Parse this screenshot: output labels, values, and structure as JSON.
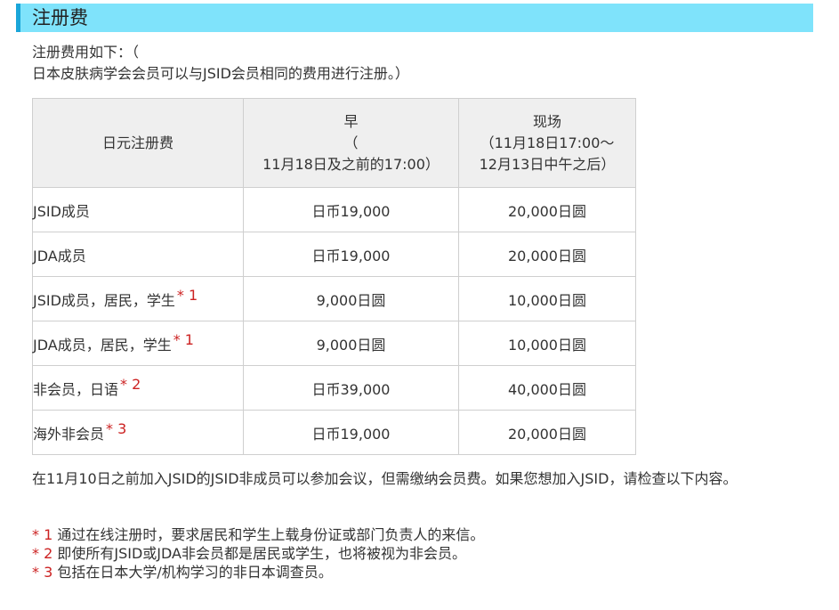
{
  "section": {
    "title": "注册费"
  },
  "intro": {
    "line1": "注册费用如下：（",
    "line2": "日本皮肤病学会会员可以与JSID会员相同的费用进行注册。）"
  },
  "fee_table": {
    "headers": {
      "category": "日元注册费",
      "early_title": "早",
      "early_paren": "（",
      "early_date": "11月18日及之前的17:00）",
      "onsite_title": "现场",
      "onsite_date1": "（11月18日17:00〜",
      "onsite_date2": "12月13日中午之后）"
    },
    "rows": [
      {
        "category": "JSID成员",
        "footnote": "",
        "early": "日币19,000",
        "onsite": "20,000日圆"
      },
      {
        "category": "JDA成员",
        "footnote": "",
        "early": "日币19,000",
        "onsite": "20,000日圆"
      },
      {
        "category": "JSID成员，居民，学生",
        "footnote": "* 1",
        "early": "9,000日圆",
        "onsite": "10,000日圆"
      },
      {
        "category": "JDA成员，居民，学生",
        "footnote": "* 1",
        "early": "9,000日圆",
        "onsite": "10,000日圆"
      },
      {
        "category": "非会员，日语",
        "footnote": "* 2",
        "early": "日币39,000",
        "onsite": "40,000日圆"
      },
      {
        "category": "海外非会员",
        "footnote": "* 3",
        "early": "日币19,000",
        "onsite": "20,000日圆"
      }
    ]
  },
  "note": "在11月10日之前加入JSID的JSID非成员可以参加会议，但需缴纳会员费。如果您想加入JSID，请检查以下内容。",
  "footnotes": [
    {
      "ref": "* 1",
      "text": " 通过在线注册时，要求居民和学生上载身份证或部门负责人的来信。"
    },
    {
      "ref": "* 2",
      "text": " 即使所有JSID或JDA非会员都是居民或学生，也将被视为非会员。"
    },
    {
      "ref": "* 3",
      "text": " 包括在日本大学/机构学习的非日本调查员。"
    }
  ],
  "colors": {
    "header_bg": "#7fe3fb",
    "header_accent": "#1aa6d9",
    "table_header_bg": "#efefef",
    "table_border": "#cfcfcf",
    "footnote_red": "#cc2222",
    "text": "#333333"
  }
}
